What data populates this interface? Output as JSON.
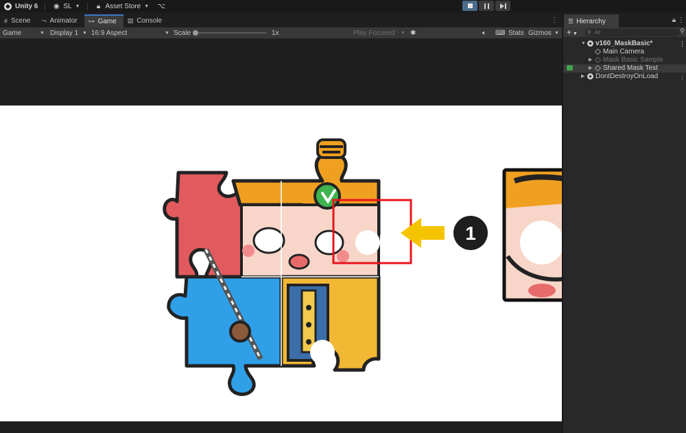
{
  "topbar": {
    "app_title": "Unity 6",
    "account": "SL",
    "asset_store": "Asset Store"
  },
  "tabs": [
    {
      "label": "Scene",
      "icon": "grid-icon"
    },
    {
      "label": "Animator",
      "icon": "animator-icon"
    },
    {
      "label": "Game",
      "icon": "gamepad-icon",
      "active": true
    },
    {
      "label": "Console",
      "icon": "console-icon"
    }
  ],
  "game_toolbar": {
    "view_mode": "Game",
    "display": "Display 1",
    "aspect": "16:9 Aspect",
    "scale_label": "Scale",
    "scale_value": "1x",
    "play_mode": "Play Focused",
    "stats": "Stats",
    "gizmos": "Gizmos"
  },
  "annotation": {
    "marker": "1",
    "highlight_color": "#e8141c",
    "arrow_color": "#f5c400"
  },
  "hierarchy": {
    "tab_label": "Hierarchy",
    "search_placeholder": "All",
    "items": [
      {
        "label": "v160_MaskBasic*",
        "type": "scene",
        "expanded": true
      },
      {
        "label": "Main Camera",
        "type": "gameobject"
      },
      {
        "label": "Mask Basic Sample",
        "type": "gameobject",
        "disabled": true,
        "collapsed": true
      },
      {
        "label": "Shared Mask Test",
        "type": "gameobject",
        "collapsed": true,
        "selected": true
      },
      {
        "label": "DontDestroyOnLoad",
        "type": "scene",
        "collapsed": true
      }
    ]
  },
  "colors": {
    "editor_bg": "#282828",
    "toolbar_bg": "#383838",
    "accent_blue": "#3c78c8",
    "puzzle_red": "#e05a5e",
    "puzzle_blue": "#2f9fe8",
    "puzzle_yellow": "#f2b733",
    "puzzle_orange": "#f0a020"
  }
}
